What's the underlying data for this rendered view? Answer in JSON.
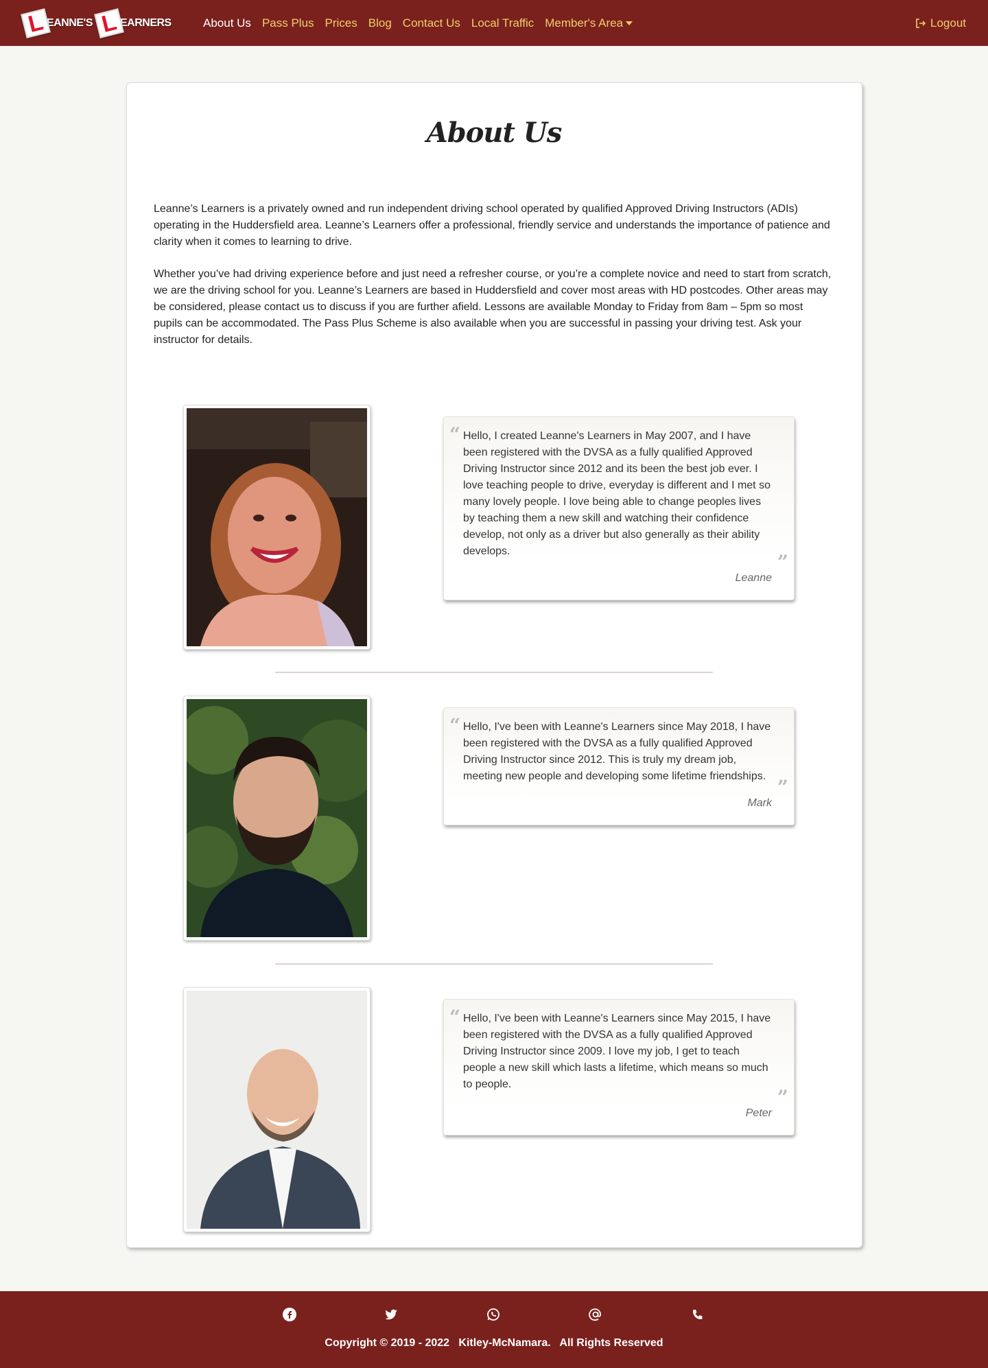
{
  "brand": {
    "word1": "EANNE'S",
    "word2": "EARNERS",
    "plate_letter": "L"
  },
  "nav": {
    "items": [
      {
        "label": "About Us",
        "active": true
      },
      {
        "label": "Pass Plus",
        "active": false
      },
      {
        "label": "Prices",
        "active": false
      },
      {
        "label": "Blog",
        "active": false
      },
      {
        "label": "Contact Us",
        "active": false
      },
      {
        "label": "Local Traffic",
        "active": false
      },
      {
        "label": "Member's Area",
        "active": false
      }
    ],
    "logout_label": "Logout"
  },
  "page": {
    "title": "About Us",
    "intro_p1": "Leanne’s Learners is a privately owned and run independent driving school operated by qualified Approved Driving Instructors (ADIs) operating in the Huddersfield area. Leanne’s Learners offer a professional, friendly service and understands the importance of patience and clarity when it comes to learning to drive.",
    "intro_p2": "Whether you’ve had driving experience before and just need a refresher course, or you’re a complete novice and need to start from scratch, we are the driving school for you. Leanne’s Learners are based in Huddersfield and cover most areas with HD postcodes. Other areas may be considered, please contact us to discuss if you are further afield. Lessons are available Monday to Friday from 8am – 5pm so most pupils can be accommodated. The Pass Plus Scheme is also available when you are successful in passing your driving test. Ask your instructor for details."
  },
  "team": [
    {
      "name": "Leanne",
      "quote": "Hello, I created Leanne's Learners in May 2007, and I have been registered with the DVSA as a fully qualified Approved Driving Instructor since 2012 and its been the best job ever. I love teaching people to drive, everyday is different and I met so many lovely people. I love being able to change peoples lives by teaching them a new skill and watching their confidence develop, not only as a driver but also generally as their ability develops."
    },
    {
      "name": "Mark",
      "quote": "Hello, I've been with Leanne's Learners since May 2018, I have been registered with the DVSA as a fully qualified Approved Driving Instructor since 2012. This is truly my dream job, meeting new people and developing some lifetime friendships."
    },
    {
      "name": "Peter",
      "quote": "Hello, I've been with Leanne's Learners since May 2015, I have been registered with the DVSA as a fully qualified Approved Driving Instructor since 2009. I love my job, I get to teach people a new skill which lasts a lifetime, which means so much to people."
    }
  ],
  "footer": {
    "icons": [
      "facebook-icon",
      "twitter-icon",
      "whatsapp-icon",
      "email-icon",
      "phone-icon"
    ],
    "copyright": "Copyright © 2019 - 2022   Kitley-McNamara.   All Rights Reserved"
  },
  "colors": {
    "brand_red": "#7a211e",
    "nav_link": "#f2cf6a",
    "active_link": "#ffffff"
  }
}
